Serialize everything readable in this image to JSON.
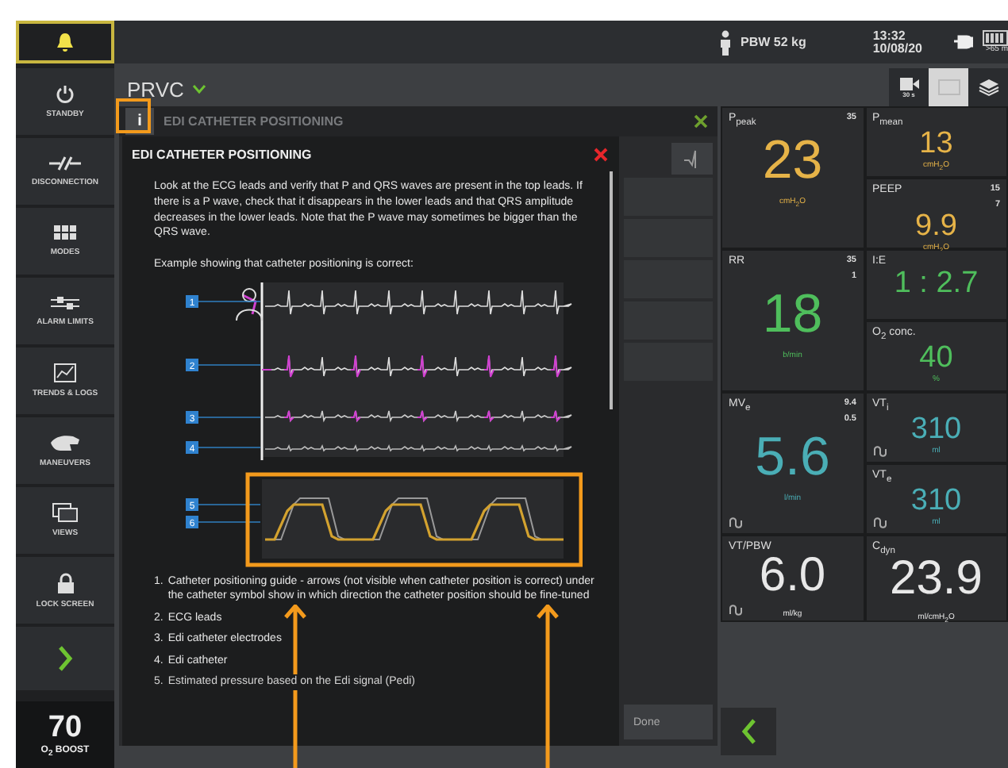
{
  "top_bar": {
    "patient": "PBW 52 kg",
    "time": "13:32",
    "date": "10/08/20",
    "battery": ">65 m"
  },
  "sidebar": {
    "items": [
      {
        "kind": "standby",
        "label": "STANDBY"
      },
      {
        "kind": "disconnection",
        "label": "DISCONNECTION"
      },
      {
        "kind": "modes",
        "label": "MODES"
      },
      {
        "kind": "alarm",
        "label": "ALARM LIMITS"
      },
      {
        "kind": "trends",
        "label": "TRENDS & LOGS"
      },
      {
        "kind": "maneuvers",
        "label": "MANEUVERS"
      },
      {
        "kind": "views",
        "label": "VIEWS"
      },
      {
        "kind": "lock",
        "label": "LOCK SCREEN"
      }
    ],
    "boost": {
      "value": "70",
      "label": "O$_{2}$ BOOST"
    }
  },
  "mode": {
    "label": "PRVC"
  },
  "view_buttons": [
    {
      "kind": "camera",
      "label": "30 s",
      "selected": false
    },
    {
      "kind": "screen",
      "selected": true
    },
    {
      "kind": "layers",
      "selected": false
    }
  ],
  "dialog": {
    "info_tab": "i",
    "title": "EDI CATHETER POSITIONING",
    "done": "Done",
    "info": {
      "title": "EDI CATHETER POSITIONING",
      "text": "Look at the ECG leads and verify that P and QRS waves are present in the top leads. If there is a P wave, check that it disappears in the lower leads and that QRS amplitude decreases in the lower leads. Note that the P wave may sometimes be bigger than the QRS wave.",
      "example": "Example showing that catheter positioning is correct:",
      "markers": [
        "1",
        "2",
        "3",
        "4",
        "5",
        "6"
      ],
      "legend": [
        {
          "number": "1.",
          "text": "Catheter positioning guide - arrows (not visible when catheter position is correct) under the catheter symbol show in which direction the catheter position should be fine-tuned"
        },
        {
          "number": "2.",
          "text": "ECG leads"
        },
        {
          "number": "3.",
          "text": "Edi catheter electrodes"
        },
        {
          "number": "4.",
          "text": "Edi catheter"
        },
        {
          "number": "5.",
          "text": "Estimated pressure based on the Edi signal (Pedi)"
        }
      ]
    }
  },
  "metrics": [
    {
      "kind": "large",
      "label": "P$_{peak}$",
      "value": "23",
      "unit": "cmH$_{2}$O",
      "limits": [
        "35"
      ],
      "color": "#e6b348",
      "loop": false
    },
    {
      "kind": "small",
      "label": "P$_{mean}$",
      "value": "13",
      "unit": "cmH$_{2}$O",
      "color": "#e6b348",
      "loop": false
    },
    {
      "kind": "small",
      "label": "PEEP",
      "value": "9.9",
      "unit": "cmH$_{2}$O",
      "limits": [
        "15",
        "7"
      ],
      "color": "#e6b348",
      "loop": false
    },
    {
      "kind": "large",
      "label": "RR",
      "value": "18",
      "unit": "b/min",
      "limits": [
        "35",
        "1"
      ],
      "color": "#4fbe5c",
      "loop": false
    },
    {
      "kind": "small",
      "label": "I:E",
      "value": "1 : 2.7",
      "color": "#4fbe5c",
      "loop": false
    },
    {
      "kind": "small",
      "label": "O$_{2}$ conc.",
      "value": "40",
      "unit": "%",
      "color": "#4fbe5c",
      "loop": false
    },
    {
      "kind": "large",
      "label": "MV$_{e}$",
      "value": "5.6",
      "unit": "l/min",
      "limits": [
        "9.4",
        "0.5"
      ],
      "color": "#4aaeb6",
      "loop": true
    },
    {
      "kind": "small",
      "label": "VT$_{i}$",
      "value": "310",
      "unit": "ml",
      "color": "#4aaeb6",
      "loop": true
    },
    {
      "kind": "small",
      "label": "VT$_{e}$",
      "value": "310",
      "unit": "ml",
      "color": "#4aaeb6",
      "loop": true
    },
    {
      "kind": "large",
      "label": "VT/PBW",
      "value": "6.0",
      "unit": "ml/kg",
      "color": "#e8e8e8",
      "loop": true
    },
    {
      "kind": "large",
      "label": "C$_{dyn}$",
      "value": "23.9",
      "unit": "ml/cmH$_{2}$O",
      "color": "#e8e8e8",
      "loop": false
    }
  ]
}
